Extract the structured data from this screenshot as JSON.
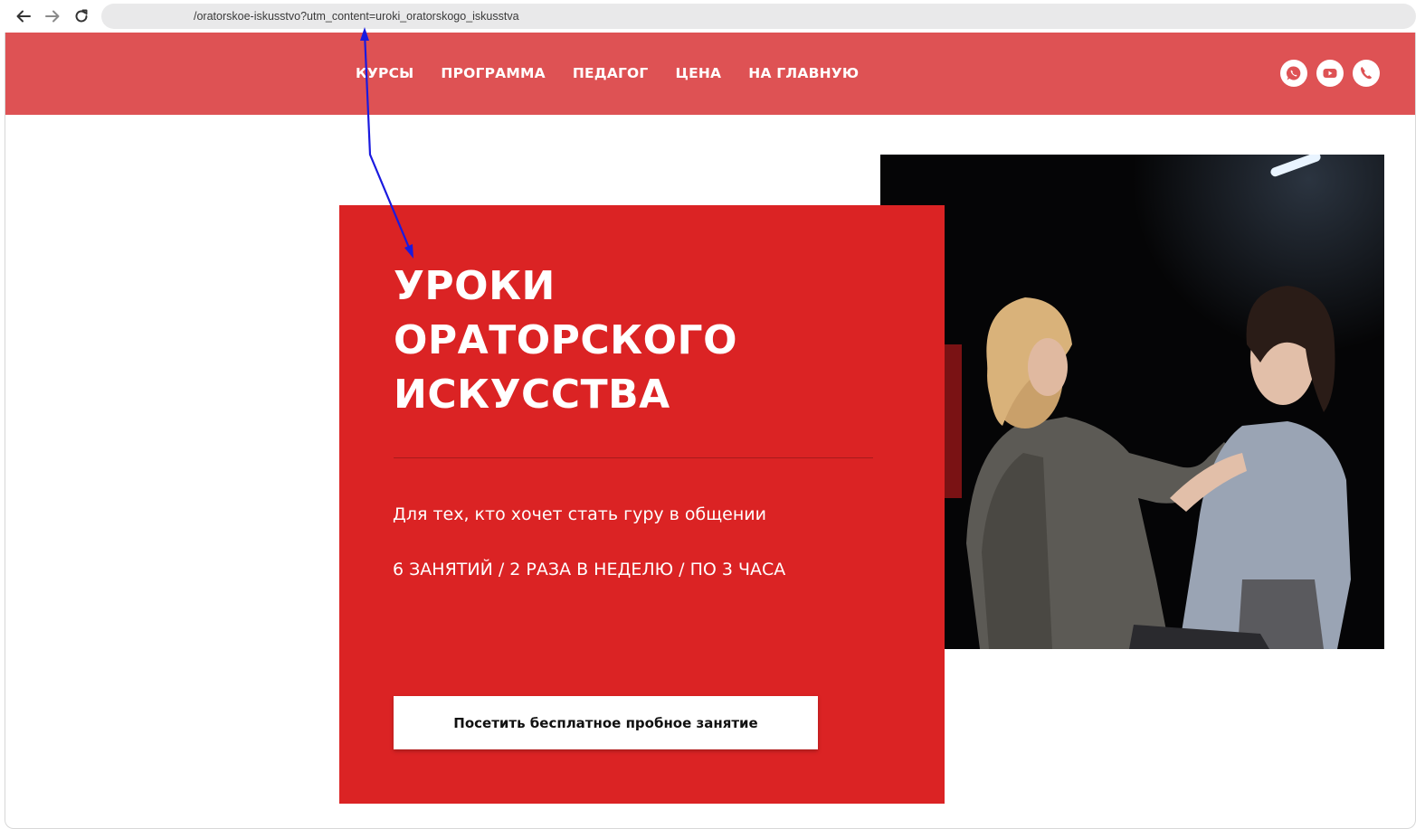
{
  "browser": {
    "url": "/oratorskoe-iskusstvo?utm_content=uroki_oratorskogo_iskusstva"
  },
  "header": {
    "background": "#de5254",
    "nav": [
      {
        "label": "КУРСЫ"
      },
      {
        "label": "ПРОГРАММА"
      },
      {
        "label": "ПЕДАГОГ"
      },
      {
        "label": "ЦЕНА"
      },
      {
        "label": "НА ГЛАВНУЮ"
      }
    ],
    "icons": [
      "whatsapp-icon",
      "youtube-icon",
      "phone-icon"
    ]
  },
  "hero": {
    "accent": "#db2324",
    "title_lines": [
      "УРОКИ",
      "ОРАТОРСКОГО",
      "ИСКУССТВА"
    ],
    "subtitle": "Для тех, кто хочет стать гуру в общении",
    "schedule": "6 ЗАНЯТИЙ / 2 РАЗА В НЕДЕЛЮ / ПО 3 ЧАСА",
    "cta_label": "Посетить бесплатное пробное занятие"
  },
  "annotation": {
    "color": "#1a1adf"
  }
}
